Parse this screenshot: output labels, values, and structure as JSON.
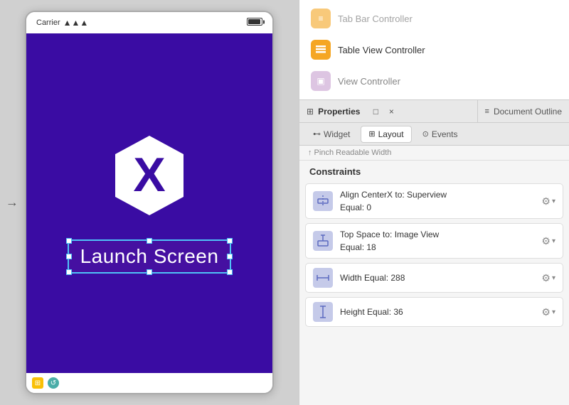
{
  "simulator": {
    "status_bar": {
      "carrier": "Carrier",
      "wifi_symbol": "📶"
    },
    "launch_text": "Launch Screen",
    "bottom_icons": [
      "⊞",
      "↺"
    ]
  },
  "component_list": {
    "items": [
      {
        "icon": "≡",
        "icon_style": "orange",
        "label": "Table View Controller"
      },
      {
        "icon": "▣",
        "icon_style": "yellow",
        "label": "View Controller",
        "faded": true
      }
    ]
  },
  "properties_panel": {
    "title": "Properties",
    "close_btn": "□",
    "x_btn": "×",
    "document_outline_label": "Document Outline",
    "tabs": [
      {
        "id": "widget",
        "label": "Widget",
        "icon": "⊷"
      },
      {
        "id": "layout",
        "label": "Layout",
        "icon": "⊞",
        "active": true
      },
      {
        "id": "events",
        "label": "Events",
        "icon": "⊙"
      }
    ],
    "scroll_hint": "↑ Pinch Readable Width",
    "constraints_title": "Constraints",
    "constraints": [
      {
        "id": "align-centerx",
        "icon_type": "centerx",
        "line1": "Align CenterX to: Superview",
        "line2": "Equal:  0"
      },
      {
        "id": "top-space",
        "icon_type": "topspace",
        "line1": "Top Space to:  Image View",
        "line2": "Equal:  18"
      },
      {
        "id": "width-equal",
        "icon_type": "width",
        "line1": "Width Equal:  288"
      },
      {
        "id": "height-equal",
        "icon_type": "height",
        "line1": "Height Equal:  36"
      }
    ]
  }
}
